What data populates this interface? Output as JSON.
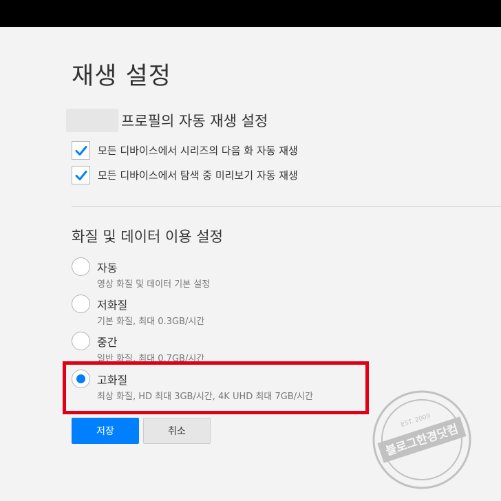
{
  "page": {
    "title": "재생 설정"
  },
  "autoplay": {
    "heading": "프로필의 자동 재생 설정",
    "options": [
      {
        "label": "모든 디바이스에서 시리즈의 다음 화 자동 재생",
        "checked": true
      },
      {
        "label": "모든 디바이스에서 탐색 중 미리보기 자동 재생",
        "checked": true
      }
    ]
  },
  "quality": {
    "heading": "화질 및 데이터 이용 설정",
    "options": [
      {
        "label": "자동",
        "description": "영상 화질 및 데이터 기본 설정",
        "selected": false
      },
      {
        "label": "저화질",
        "description": "기본 화질, 최대 0.3GB/시간",
        "selected": false
      },
      {
        "label": "중간",
        "description": "일반 화질, 최대 0.7GB/시간",
        "selected": false
      },
      {
        "label": "고화질",
        "description": "최상 화질, HD 최대 3GB/시간, 4K UHD 최대 7GB/시간",
        "selected": true
      }
    ]
  },
  "buttons": {
    "save": "저장",
    "cancel": "취소"
  },
  "colors": {
    "accent": "#0080ff",
    "highlight": "#e00015",
    "background": "#f3f3f3"
  },
  "watermark": {
    "main": "블로그한경닷컴",
    "sub": "EST. 2009"
  }
}
